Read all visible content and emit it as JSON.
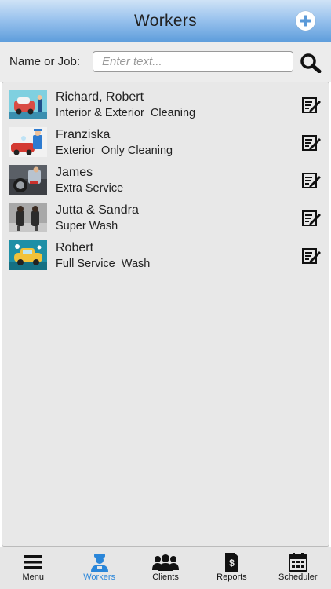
{
  "header": {
    "title": "Workers",
    "add_icon": "plus-circle-icon"
  },
  "search": {
    "label": "Name or Job:",
    "placeholder": "Enter text...",
    "value": "",
    "icon": "search-icon"
  },
  "workers": [
    {
      "name": "Richard, Robert",
      "job": "Interior & Exterior  Cleaning",
      "thumb": "car-wash-photo-1"
    },
    {
      "name": "Franziska",
      "job": "Exterior  Only Cleaning",
      "thumb": "car-wash-photo-2"
    },
    {
      "name": "James",
      "job": "Extra Service",
      "thumb": "car-wash-photo-3"
    },
    {
      "name": "Jutta & Sandra",
      "job": "Super Wash",
      "thumb": "car-wash-photo-4"
    },
    {
      "name": "Robert",
      "job": "Full Service  Wash",
      "thumb": "car-wash-photo-5"
    }
  ],
  "tabs": [
    {
      "label": "Menu",
      "icon": "hamburger-menu-icon",
      "active": false
    },
    {
      "label": "Workers",
      "icon": "worker-icon",
      "active": true
    },
    {
      "label": "Clients",
      "icon": "people-group-icon",
      "active": false
    },
    {
      "label": "Reports",
      "icon": "report-document-icon",
      "active": false
    },
    {
      "label": "Scheduler",
      "icon": "calendar-icon",
      "active": false
    }
  ],
  "colors": {
    "header_top": "#cfe3f6",
    "header_bottom": "#5f9edc",
    "active_tab": "#2a86d9",
    "list_bg": "#e8e8e8"
  }
}
